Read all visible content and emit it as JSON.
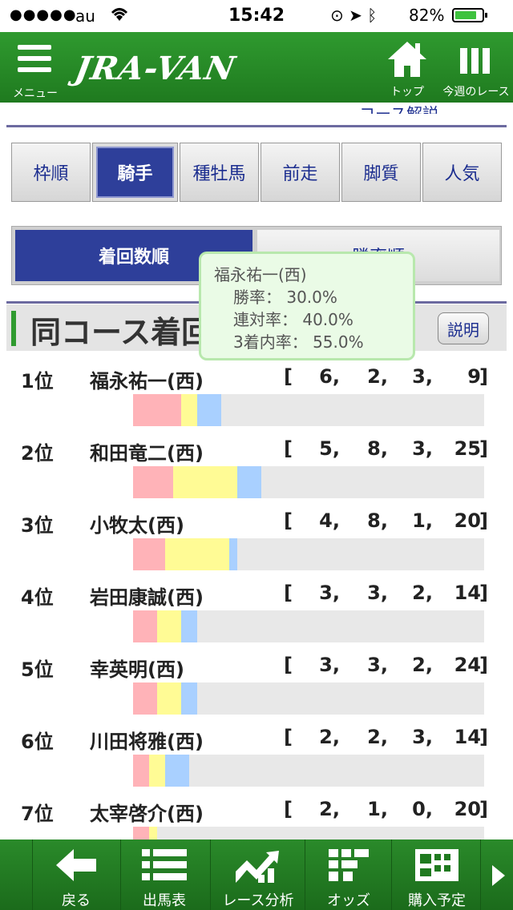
{
  "status": {
    "signal": "●●●●●",
    "carrier": "au",
    "time": "15:42",
    "battery": "82%",
    "battery_level": 0.82
  },
  "header": {
    "menu_label": "メニュー",
    "logo": "JRA-VAN",
    "top_label": "トップ",
    "race_label": "今週のレース"
  },
  "sublink": "コース解説",
  "tabs": [
    "枠順",
    "騎手",
    "種牡馬",
    "前走",
    "脚質",
    "人気"
  ],
  "sort": {
    "left": "着回数順",
    "right": "勝率順"
  },
  "section": {
    "title": "同コース着回",
    "explain": "説明"
  },
  "tooltip": {
    "name": "福永祐一(西)",
    "win": "勝率：  30.0%",
    "place": "連対率：  40.0%",
    "show": "3着内率：  55.0%"
  },
  "rows": [
    {
      "rank": "1位",
      "name": "福永祐一(西)",
      "a": "6,",
      "b": "2,",
      "c": "3,",
      "d": "9",
      "firsts": 6,
      "seconds": 2,
      "thirds": 3,
      "others": 9
    },
    {
      "rank": "2位",
      "name": "和田竜二(西)",
      "a": "5,",
      "b": "8,",
      "c": "3,",
      "d": "25",
      "firsts": 5,
      "seconds": 8,
      "thirds": 3,
      "others": 25
    },
    {
      "rank": "3位",
      "name": "小牧太(西)",
      "a": "4,",
      "b": "8,",
      "c": "1,",
      "d": "20",
      "firsts": 4,
      "seconds": 8,
      "thirds": 1,
      "others": 20
    },
    {
      "rank": "4位",
      "name": "岩田康誠(西)",
      "a": "3,",
      "b": "3,",
      "c": "2,",
      "d": "14",
      "firsts": 3,
      "seconds": 3,
      "thirds": 2,
      "others": 14
    },
    {
      "rank": "5位",
      "name": "幸英明(西)",
      "a": "3,",
      "b": "3,",
      "c": "2,",
      "d": "24",
      "firsts": 3,
      "seconds": 3,
      "thirds": 2,
      "others": 24
    },
    {
      "rank": "6位",
      "name": "川田将雅(西)",
      "a": "2,",
      "b": "2,",
      "c": "3,",
      "d": "14",
      "firsts": 2,
      "seconds": 2,
      "thirds": 3,
      "others": 14
    },
    {
      "rank": "7位",
      "name": "太宰啓介(西)",
      "a": "2,",
      "b": "1,",
      "c": "0,",
      "d": "20",
      "firsts": 2,
      "seconds": 1,
      "thirds": 0,
      "others": 20
    }
  ],
  "colors": {
    "first": "#ffb3b8",
    "second": "#fffb95",
    "third": "#a9d0ff",
    "accent": "#2e3f9a",
    "brand": "#2f9a2f"
  },
  "footer": [
    "戻る",
    "出馬表",
    "レース分析",
    "オッズ",
    "購入予定"
  ]
}
